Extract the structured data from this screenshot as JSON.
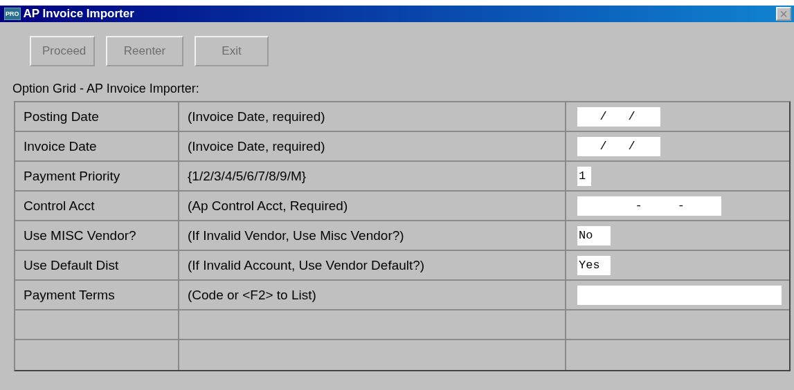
{
  "window": {
    "title": "AP Invoice Importer",
    "app_badge": "PRO",
    "close": "×"
  },
  "buttons": [
    {
      "label": "Proceed",
      "disabled": true
    },
    {
      "label": "Reenter",
      "disabled": true
    },
    {
      "label": "Exit",
      "disabled": true
    }
  ],
  "grid_title": "Option Grid - AP Invoice Importer:",
  "rows": [
    {
      "kind": "date",
      "option": "Posting Date",
      "description": "(Invoice Date, required)",
      "value": "   /   /"
    },
    {
      "kind": "date",
      "option": "Invoice Date",
      "description": "(Invoice Date, required)",
      "value": "   /   /"
    },
    {
      "kind": "char",
      "option": "Payment Priority",
      "description": "{1/2/3/4/5/6/7/8/9/M}",
      "value": "1"
    },
    {
      "kind": "account",
      "option": "Control Acct",
      "description": "(Ap Control Acct, Required)",
      "value": "        -     -"
    },
    {
      "kind": "flag",
      "option": "Use MISC Vendor?",
      "description": "(If Invalid Vendor, Use Misc Vendor?)",
      "value": "No"
    },
    {
      "kind": "flag",
      "option": "Use Default Dist",
      "description": "(If Invalid Account, Use Vendor Default?)",
      "value": "Yes"
    },
    {
      "kind": "code",
      "option": "Payment Terms",
      "description": "(Code or <F2> to List)"
    },
    {
      "kind": "empty"
    },
    {
      "kind": "empty"
    }
  ]
}
